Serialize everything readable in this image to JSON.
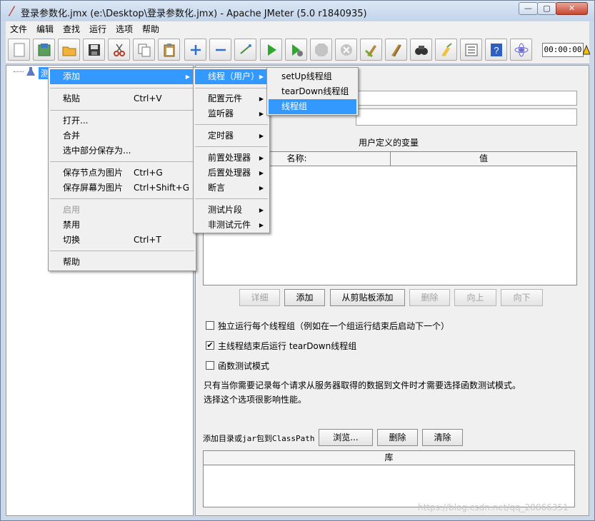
{
  "window": {
    "title": "登录参数化.jmx (e:\\Desktop\\登录参数化.jmx) - Apache JMeter (5.0 r1840935)",
    "min": "—",
    "max": "▢",
    "close": "✕"
  },
  "menubar": [
    "文件",
    "编辑",
    "查找",
    "运行",
    "选项",
    "帮助"
  ],
  "toolbar": {
    "icons": [
      "new-icon",
      "templates-icon",
      "open-icon",
      "save-icon",
      "cut-icon",
      "copy-icon",
      "paste-icon",
      "expand-icon",
      "collapse-icon",
      "toggle-icon",
      "start-icon",
      "start-no-pause-icon",
      "stop-icon",
      "shutdown-icon",
      "clear-icon",
      "clear-all-icon",
      "search-icon",
      "reset-search-icon",
      "function-helper-icon",
      "help-icon",
      "remote-icon"
    ],
    "timer": "00:00:00"
  },
  "tree": {
    "root_label": "测"
  },
  "context_menu": {
    "items": [
      {
        "label": "添加",
        "shortcut": "",
        "submenu": true,
        "selected": true
      },
      {
        "label": "粘贴",
        "shortcut": "Ctrl+V"
      },
      {
        "label": "打开..."
      },
      {
        "label": "合并"
      },
      {
        "label": "选中部分保存为..."
      },
      {
        "label": "保存节点为图片",
        "shortcut": "Ctrl+G"
      },
      {
        "label": "保存屏幕为图片",
        "shortcut": "Ctrl+Shift+G"
      },
      {
        "label": "启用",
        "disabled": true
      },
      {
        "label": "禁用"
      },
      {
        "label": "切换",
        "shortcut": "Ctrl+T"
      },
      {
        "label": "帮助"
      }
    ]
  },
  "add_submenu": {
    "items": [
      "线程（用户）",
      "配置元件",
      "监听器",
      "定时器",
      "前置处理器",
      "后置处理器",
      "断言",
      "测试片段",
      "非测试元件"
    ]
  },
  "thread_submenu": {
    "items": [
      "setUp线程组",
      "tearDown线程组",
      "线程组"
    ]
  },
  "right_panel": {
    "udv_title": "用户定义的变量",
    "col_name": "名称:",
    "col_value": "值",
    "buttons": [
      "详细",
      "添加",
      "从剪贴板添加",
      "删除",
      "向上",
      "向下"
    ],
    "checkbox1": "独立运行每个线程组（例如在一个组运行结束后启动下一个）",
    "checkbox1_checked": false,
    "checkbox2": "主线程结束后运行 tearDown线程组",
    "checkbox2_checked": true,
    "checkbox3": "函数测试模式",
    "checkbox3_checked": false,
    "note1": "只有当你需要记录每个请求从服务器取得的数据到文件时才需要选择函数测试模式。",
    "note2": "选择这个选项很影响性能。",
    "classpath_label": "添加目录或jar包到ClassPath",
    "browse": "浏览...",
    "delete": "删除",
    "clear": "清除",
    "lib_col": "库"
  },
  "watermark": "https://blog.csdn.net/qq_28866351"
}
